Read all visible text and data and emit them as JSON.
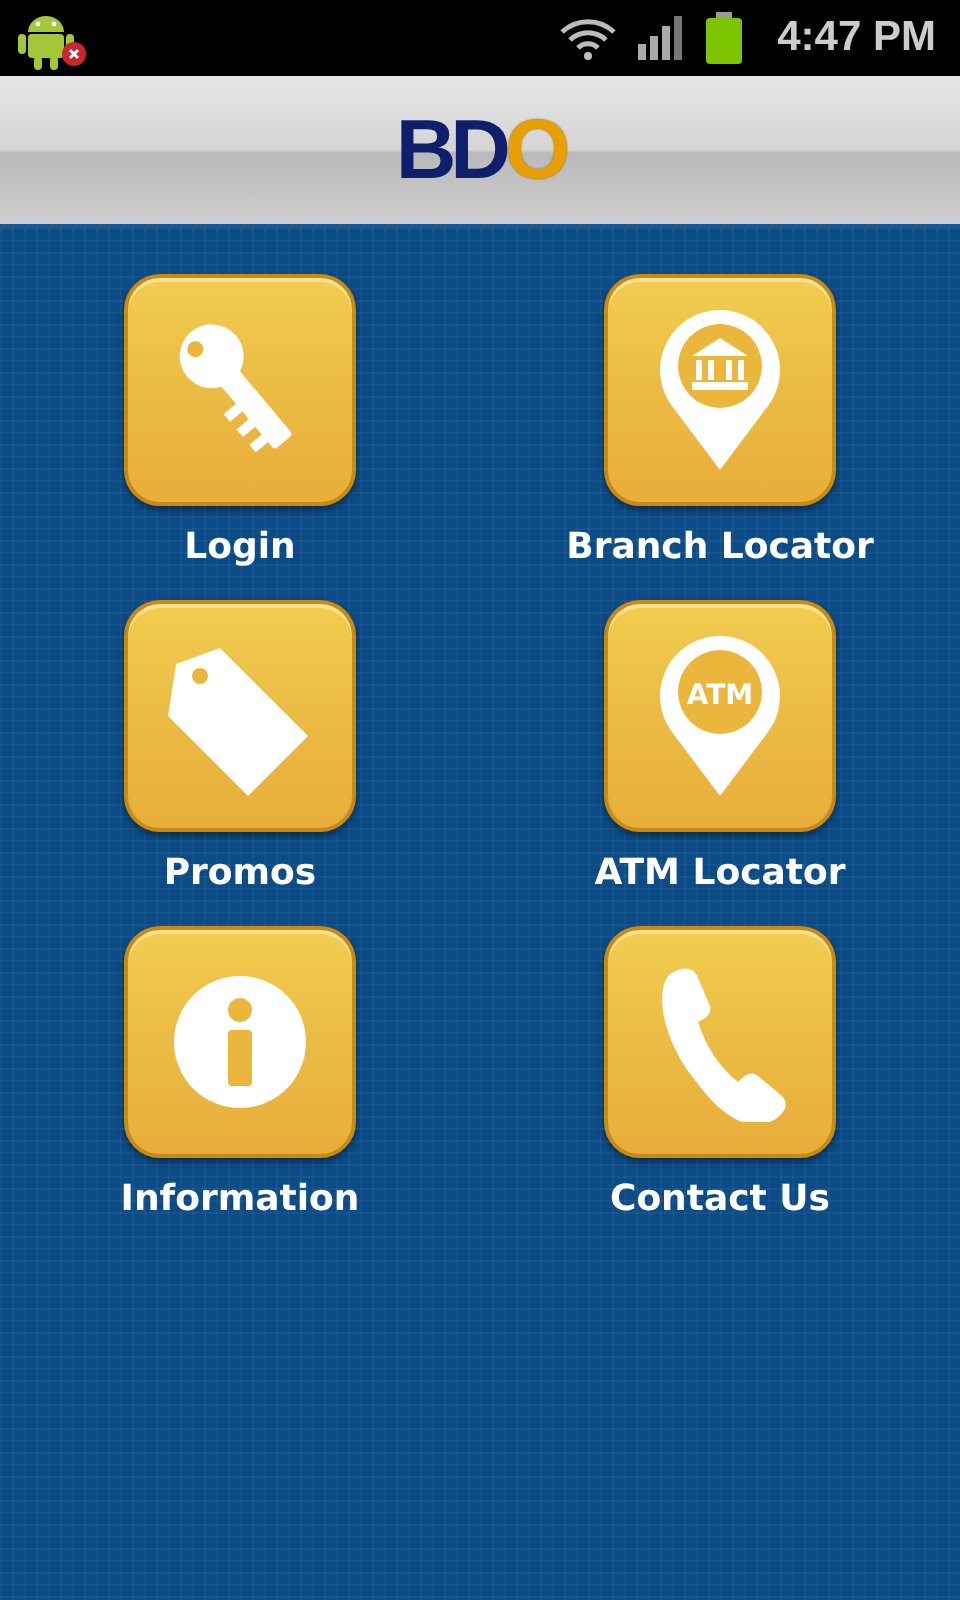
{
  "status_bar": {
    "time": "4:47 PM"
  },
  "header": {
    "logo_main": "BD",
    "logo_accent": "O"
  },
  "menu": [
    {
      "label": "Login",
      "kind": "key"
    },
    {
      "label": "Promos",
      "kind": "tag"
    },
    {
      "label": "Information",
      "kind": "info"
    },
    {
      "label": "Branch Locator",
      "kind": "bank-pin"
    },
    {
      "label": "ATM Locator",
      "kind": "atm-pin",
      "icon_text": "ATM"
    },
    {
      "label": "Contact Us",
      "kind": "phone"
    }
  ]
}
